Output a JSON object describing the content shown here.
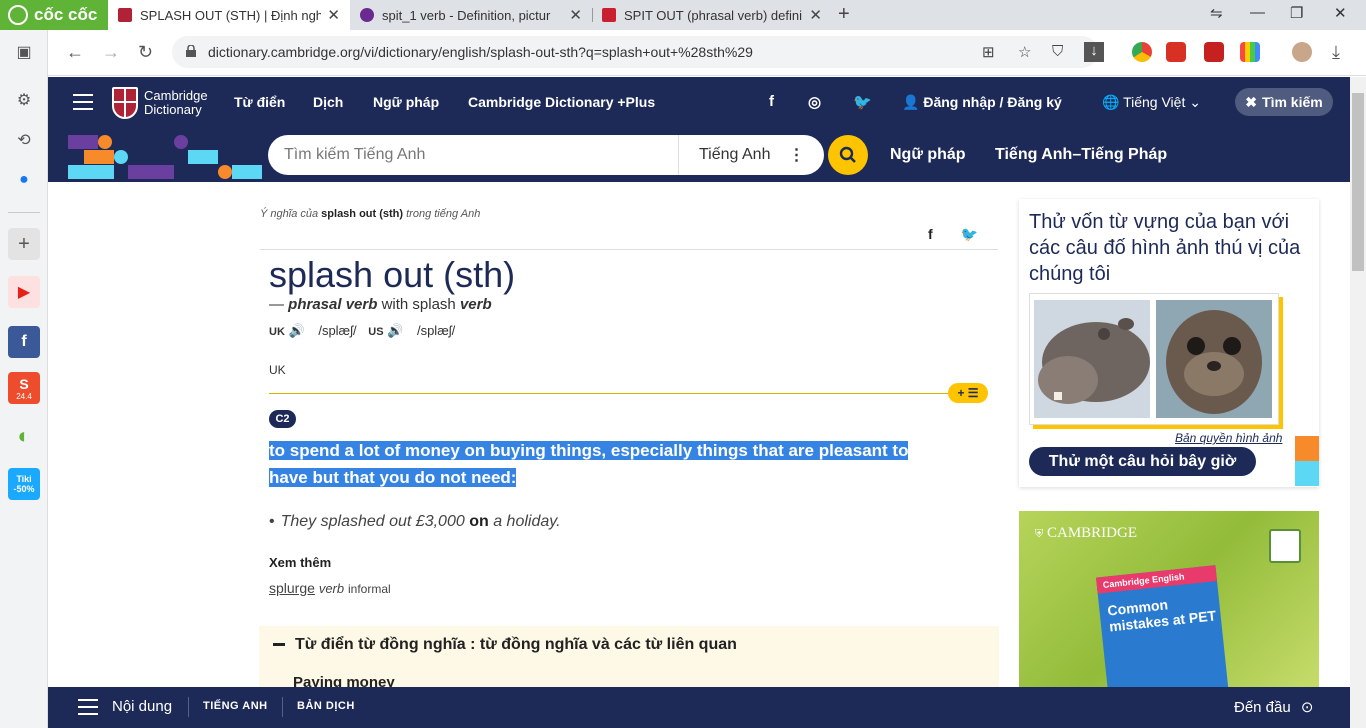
{
  "browser": {
    "brand": "cốc cốc",
    "tabs": [
      {
        "title": "SPLASH OUT (STH) | Định nghĩa"
      },
      {
        "title": "spit_1 verb - Definition, pictur"
      },
      {
        "title": "SPIT OUT (phrasal verb) defini"
      }
    ],
    "url": "dictionary.cambridge.org/vi/dictionary/english/splash-out-sth?q=splash+out+%28sth%29",
    "rail_badge_shopee": "24.4",
    "rail_badge_tiki": "Tiki -50%"
  },
  "header": {
    "logo_line1": "Cambridge",
    "logo_line2": "Dictionary",
    "nav": [
      "Từ điển",
      "Dịch",
      "Ngữ pháp",
      "Cambridge Dictionary +Plus"
    ],
    "login": "Đăng nhập / Đăng ký",
    "language": "Tiếng Việt",
    "search_button": "Tìm kiếm"
  },
  "searchbar": {
    "placeholder": "Tìm kiếm Tiếng Anh",
    "lang": "Tiếng Anh",
    "nav": [
      "Ngữ pháp",
      "Tiếng Anh–Tiếng Pháp"
    ]
  },
  "entry": {
    "breadcrumb_pre": "Ý nghĩa của",
    "breadcrumb_word": "splash out (sth)",
    "breadcrumb_post": "trong tiếng Anh",
    "headword": "splash out (sth)",
    "pos_dash": "—",
    "pos": "phrasal verb",
    "pos_with": "with splash",
    "pos_verb": "verb",
    "uk_label": "UK",
    "uk_ipa": "/splæʃ/",
    "us_label": "US",
    "us_ipa": "/splæʃ/",
    "region": "UK",
    "level": "C2",
    "definition_line1": "to spend a lot of money on buying things, especially things that are pleasant to",
    "definition_line2": "have but that you do not need:",
    "example_pre": "They splashed out £3,000",
    "example_bold": "on",
    "example_post": "a holiday.",
    "see_also_label": "Xem thêm",
    "see_also_word": "splurge",
    "see_also_pos": "verb",
    "see_also_register": "informal",
    "thesaurus_title": "Từ điển từ đồng nghĩa : từ đồng nghĩa và các từ liên quan",
    "thesaurus_sub": "Paying money"
  },
  "sidebar": {
    "quiz_title": "Thử vốn từ vựng của bạn với các câu đố hình ảnh thú vị của chúng tôi",
    "image_credit": "Bản quyền hình ảnh",
    "quiz_button": "Thử một câu hỏi bây giờ",
    "ad_brand": "CAMBRIDGE",
    "ad_book_top": "Cambridge English",
    "ad_book_title": "Common mistakes at PET"
  },
  "footer": {
    "contents": "Nội dung",
    "tabs": [
      "TIẾNG ANH",
      "BẢN DỊCH"
    ],
    "to_top": "Đến đầu"
  },
  "colors": {
    "navy": "#1d2a57",
    "yellow": "#fec400",
    "highlight": "#3584e4"
  }
}
